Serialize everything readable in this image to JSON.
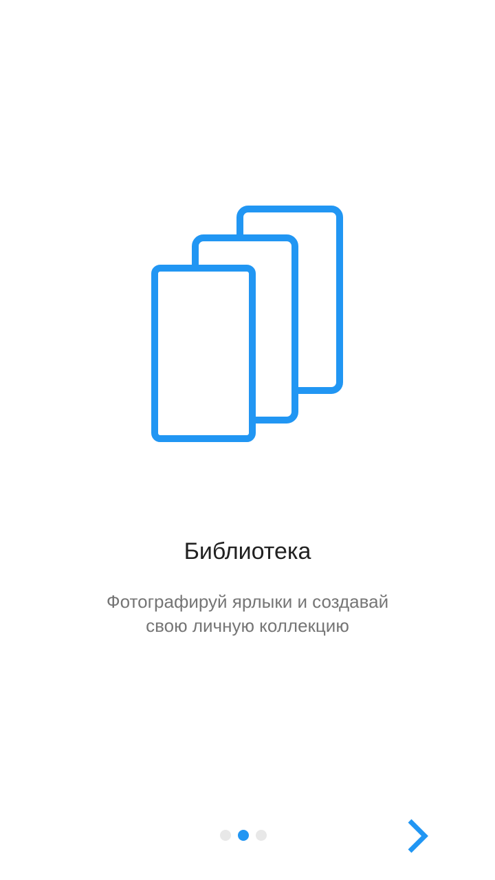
{
  "screen": {
    "title": "Библиотека",
    "subtitle_line1": "Фотографируй ярлыки и создавай",
    "subtitle_line2": "свою личную коллекцию"
  },
  "illustration": {
    "icon": "cards-stack-icon",
    "color": "#2196f3"
  },
  "pager": {
    "count": 3,
    "active_index": 1,
    "active_color": "#2196f3",
    "inactive_color": "#e8e8e8"
  },
  "navigation": {
    "next_icon": "chevron-right-icon",
    "color": "#2196f3"
  }
}
